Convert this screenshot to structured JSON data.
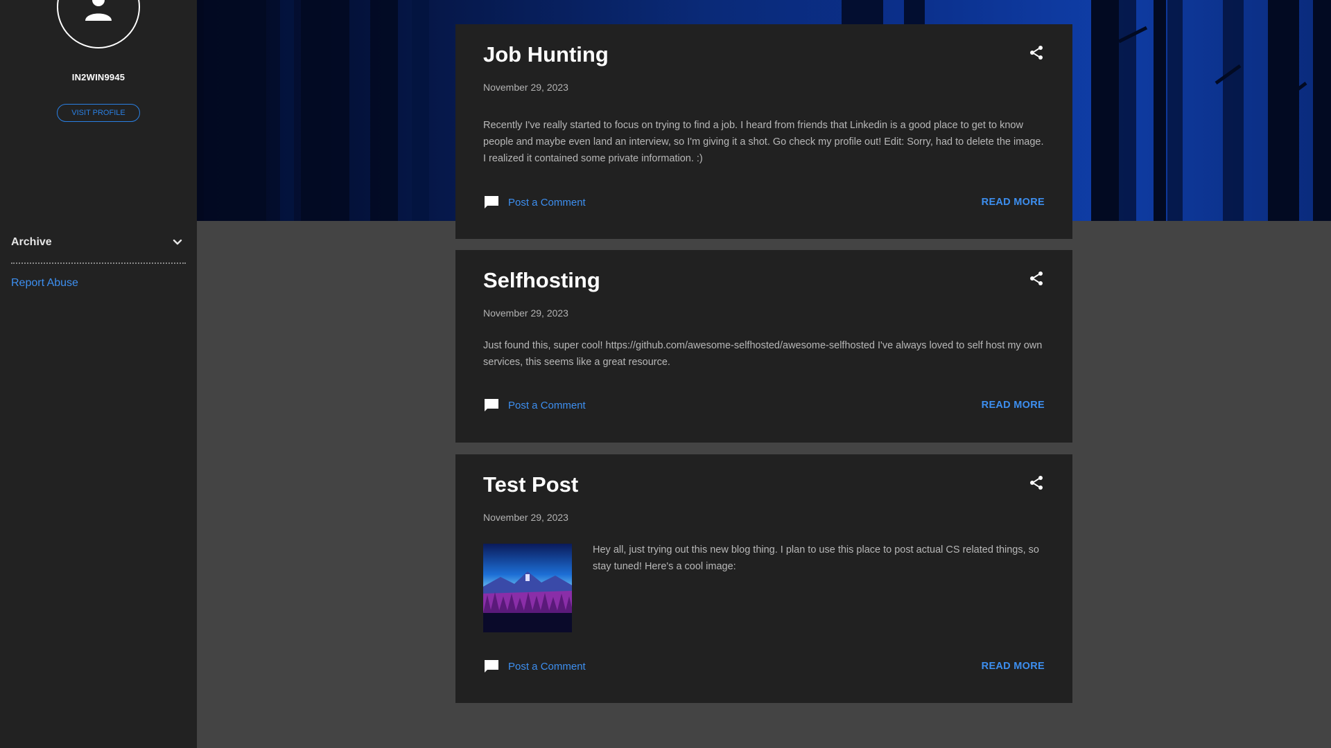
{
  "sidebar": {
    "profile_name": "IN2WIN9945",
    "visit_profile_label": "VISIT PROFILE",
    "archive_label": "Archive",
    "report_abuse_label": "Report Abuse"
  },
  "posts": [
    {
      "title": "Job Hunting",
      "date": "November 29, 2023",
      "body": "Recently I've really started to focus on trying to find a job. I heard from friends that Linkedin is a good place to get to know people and maybe even land an interview, so I'm giving it a shot. Go check my profile out! Edit: Sorry, had to delete the image. I realized it contained some private information. :)",
      "comment_label": "Post a Comment",
      "read_more_label": "READ MORE"
    },
    {
      "title": "Selfhosting",
      "date": "November 29, 2023",
      "body": " Just found this, super cool! https://github.com/awesome-selfhosted/awesome-selfhosted I've always loved to self host my own services, this seems like a great resource.",
      "comment_label": "Post a Comment",
      "read_more_label": "READ MORE"
    },
    {
      "title": "Test Post",
      "date": "November 29, 2023",
      "body": " Hey all, just trying out this new blog thing. I plan to use this place to post actual CS related things, so stay tuned! Here's a cool image:",
      "comment_label": "Post a Comment",
      "read_more_label": "READ MORE"
    }
  ],
  "icons": {
    "avatar": "person-icon",
    "archive_toggle": "chevron-down-icon",
    "share": "share-icon",
    "comment": "comment-icon"
  },
  "colors": {
    "accent": "#3d8ff0",
    "sidebar_bg": "#222222",
    "post_bg": "#212121",
    "page_bg": "#444444"
  }
}
